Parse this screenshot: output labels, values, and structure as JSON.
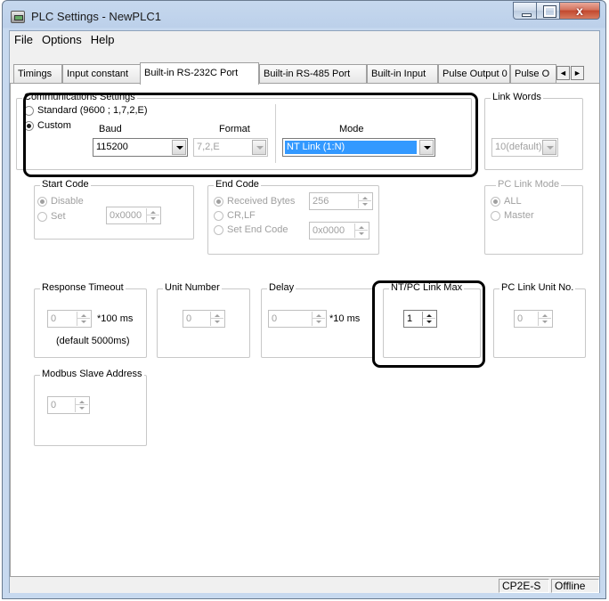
{
  "window": {
    "title": "PLC Settings - NewPLC1",
    "close_glyph": "x"
  },
  "menu": [
    "File",
    "Options",
    "Help"
  ],
  "tabs": [
    "Timings",
    "Input constant",
    "Built-in RS-232C Port",
    "Built-in RS-485 Port",
    "Built-in Input",
    "Pulse Output 0",
    "Pulse O"
  ],
  "active_tab": "Built-in RS-232C Port",
  "comm": {
    "legend": "Communications Settings",
    "standard_label": "Standard (9600 ; 1,7,2,E)",
    "custom_label": "Custom",
    "selected": "Custom",
    "baud_label": "Baud",
    "baud_value": "115200",
    "format_label": "Format",
    "format_value": "7,2,E",
    "mode_label": "Mode",
    "mode_value": "NT Link (1:N)"
  },
  "link_words": {
    "legend": "Link Words",
    "value": "10(default)"
  },
  "start_code": {
    "legend": "Start Code",
    "disable_label": "Disable",
    "set_label": "Set",
    "selected": "Disable",
    "value": "0x0000"
  },
  "end_code": {
    "legend": "End Code",
    "received_label": "Received Bytes",
    "received_value": "256",
    "crlf_label": "CR,LF",
    "set_label": "Set End Code",
    "set_value": "0x0000",
    "selected": "Received Bytes"
  },
  "pc_link_mode": {
    "legend": "PC Link Mode",
    "all_label": "ALL",
    "master_label": "Master",
    "selected": "ALL"
  },
  "response_timeout": {
    "legend": "Response Timeout",
    "value": "0",
    "unit": "*100 ms",
    "note": "(default 5000ms)"
  },
  "unit_number": {
    "legend": "Unit Number",
    "value": "0"
  },
  "delay": {
    "legend": "Delay",
    "value": "0",
    "unit": "*10 ms"
  },
  "nt_pc_link_max": {
    "legend": "NT/PC Link Max",
    "value": "1"
  },
  "pc_link_unit_no": {
    "legend": "PC Link Unit No.",
    "value": "0"
  },
  "modbus": {
    "legend": "Modbus Slave Address",
    "value": "0"
  },
  "status": {
    "model": "CP2E-S",
    "state": "Offline"
  },
  "colors": {
    "selection": "#3399ff",
    "highlight_border": "#000000"
  }
}
